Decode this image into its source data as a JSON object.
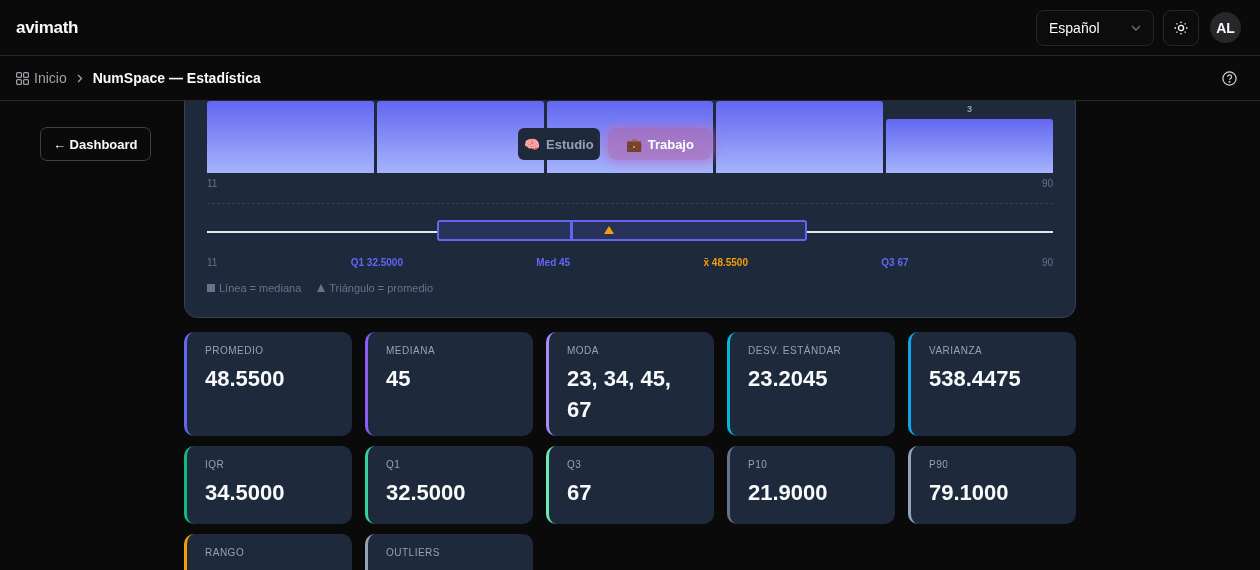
{
  "header": {
    "logo": "avimath",
    "language": "Español",
    "avatar": "AL"
  },
  "breadcrumb": {
    "home": "Inicio",
    "current": "NumSpace — Estadística"
  },
  "back_button": "← Dashboard",
  "histogram": {
    "top_label": "3",
    "x_min": "11",
    "x_max": "90"
  },
  "mode_switch": [
    {
      "icon": "🧠",
      "label": "Estudio",
      "selected": false
    },
    {
      "icon": "💼",
      "label": "Trabajo",
      "selected": true
    }
  ],
  "boxplot": {
    "min": "11",
    "max": "90",
    "q1": {
      "label": "Q1",
      "value": "32.5000"
    },
    "median": {
      "label": "Med",
      "value": "45"
    },
    "mean": {
      "label": "x̄",
      "value": "48.5500"
    },
    "q3": {
      "label": "Q3",
      "value": "67"
    },
    "legend": [
      "Línea = mediana",
      "Triángulo = promedio"
    ]
  },
  "stats": [
    {
      "label": "PROMEDIO",
      "value": "48.5500",
      "color": "#6366f1"
    },
    {
      "label": "MEDIANA",
      "value": "45",
      "color": "#8b5cf6"
    },
    {
      "label": "MODA",
      "value": "23, 34, 45, 67",
      "color": "#a78bfa"
    },
    {
      "label": "DESV. ESTÁNDAR",
      "value": "23.2045",
      "color": "#06b6d4"
    },
    {
      "label": "VARIANZA",
      "value": "538.4475",
      "color": "#0ea5e9"
    },
    {
      "label": "IQR",
      "value": "34.5000",
      "color": "#10b981"
    },
    {
      "label": "Q1",
      "value": "32.5000",
      "color": "#34d399"
    },
    {
      "label": "Q3",
      "value": "67",
      "color": "#6ee7b7"
    },
    {
      "label": "P10",
      "value": "21.9000",
      "color": "#64748b"
    },
    {
      "label": "P90",
      "value": "79.1000",
      "color": "#94a3b8"
    },
    {
      "label": "RANGO",
      "color": "#f59e0b"
    },
    {
      "label": "OUTLIERS",
      "color": "#94a3b8"
    }
  ]
}
